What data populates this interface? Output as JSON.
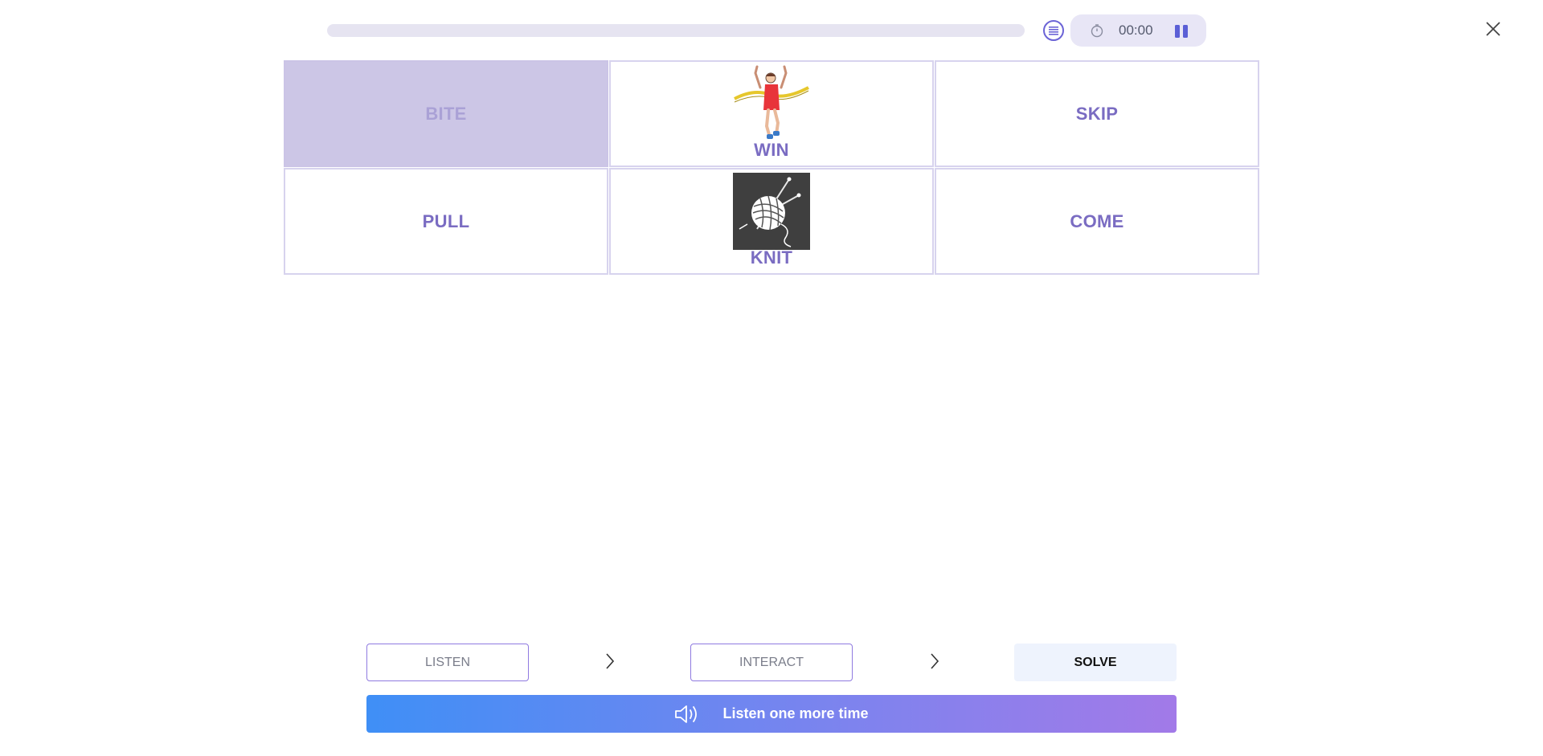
{
  "header": {
    "progress_percent": 0,
    "timer": "00:00",
    "list_icon": "list-icon",
    "clock_icon": "clock-icon",
    "pause_icon": "pause-icon",
    "close_icon": "close-icon"
  },
  "grid": {
    "cells": [
      {
        "word": "BITE",
        "selected": true,
        "image": null
      },
      {
        "word": "WIN",
        "selected": false,
        "image": "runner-finish-line-illustration"
      },
      {
        "word": "SKIP",
        "selected": false,
        "image": null
      },
      {
        "word": "PULL",
        "selected": false,
        "image": null
      },
      {
        "word": "KNIT",
        "selected": false,
        "image": "yarn-ball-knitting-needles-illustration"
      },
      {
        "word": "COME",
        "selected": false,
        "image": null
      }
    ]
  },
  "steps": {
    "listen": "LISTEN",
    "interact": "INTERACT",
    "solve": "SOLVE",
    "active_step": "SOLVE"
  },
  "listen_again": {
    "label": "Listen one more time",
    "icon": "speaker-icon"
  },
  "colors": {
    "word_text": "#7a6cc2",
    "selected_cell": "#ccc6e6",
    "gradient_start": "#3f8ff6",
    "gradient_end": "#a27ae8"
  }
}
